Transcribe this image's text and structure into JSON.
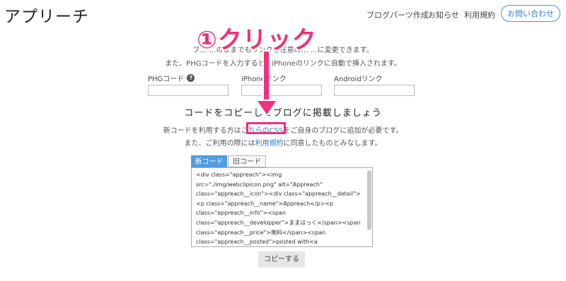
{
  "header": {
    "logo": "アプリーチ",
    "nav": [
      "ブログパーツ作成",
      "お知らせ",
      "利用規約"
    ],
    "contact_label": "お問い合わせ"
  },
  "intro": {
    "line1": "ブ… …のままでもリンクを任意の… …に変更できます。",
    "line2": "また、PHGコードを入力すると、iPhoneのリンクに自動で挿入されます。"
  },
  "fields": {
    "phg_label": "PHGコード",
    "iphone_label": "iPhoneリンク",
    "android_label": "Androidリンク",
    "help_glyph": "?"
  },
  "section": {
    "heading": "コードをコピーしてブログに掲載しましょう",
    "note1_prefix": "新コードを利用する方は",
    "note1_link": "こちらのCSS",
    "note1_suffix": "をご自身のブログに追加が必要です。",
    "note2_prefix": "また、ご利用の際には",
    "note2_link": "利用規約",
    "note2_suffix": "に同意したものとみなします。"
  },
  "tabs": {
    "new": "新コード",
    "old": "旧コード"
  },
  "code": "<div class=\"appreach\"><img src=\"./img/webclipicon.png\" alt=\"Appreach\" class=\"appreach__icon\"><div class=\"appreach__detail\"><p class=\"appreach__name\">Appreach</p><p class=\"appreach__info\"><span class=\"appreach__developper\">ままはっく</span><span class=\"appreach__price\">無料</span><span class=\"appreach__posted\">posted with<a href=\"http://mama-hack.com/app-reach/\" title=\"アプリーチ\" target=\"_blank\" rel=\"nofollow\">アプリーチ</a></span></p>",
  "copy_label": "コピーする",
  "annotation": {
    "label": "①クリック",
    "color": "#f0307a"
  }
}
